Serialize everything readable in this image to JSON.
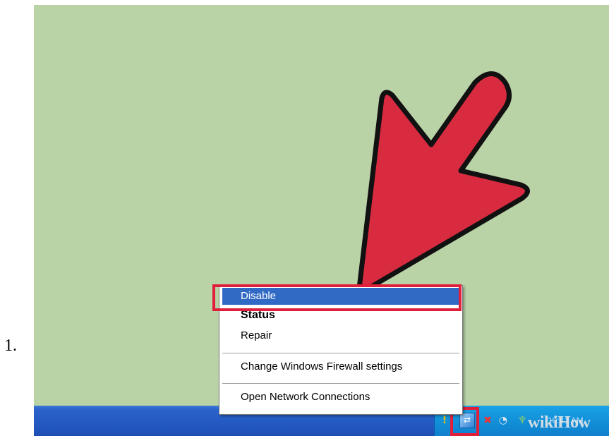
{
  "list_marker": "1.",
  "context_menu": {
    "items": [
      {
        "label": "Disable"
      },
      {
        "label": "Status"
      },
      {
        "label": "Repair"
      },
      {
        "label": "Change Windows Firewall settings"
      },
      {
        "label": "Open Network Connections"
      }
    ]
  },
  "taskbar": {
    "tray_icons": [
      "shield-icon",
      "network-icon",
      "security-center-icon",
      "speaker-icon",
      "wifi-icon"
    ],
    "clock": "10:41 AM"
  },
  "watermark": "wikiHow",
  "colors": {
    "desktop": "#b9d2a6",
    "highlight_box": "#e0203a",
    "arrow": "#d92b40",
    "menu_selection": "#316ac5"
  }
}
